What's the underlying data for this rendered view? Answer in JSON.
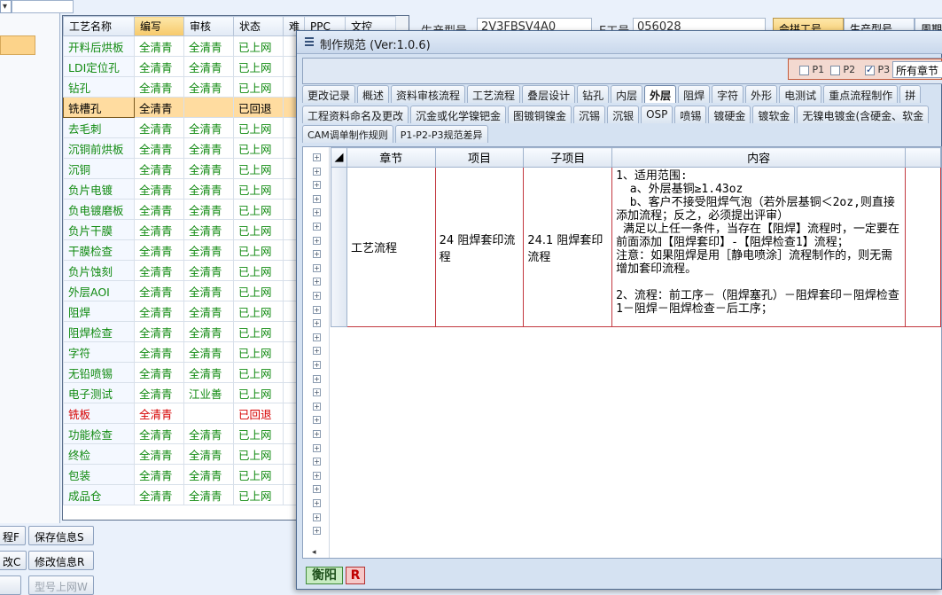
{
  "grid": {
    "columns": [
      "工艺名称",
      "编写",
      "审核",
      "状态",
      "难",
      "PPC",
      "文控"
    ],
    "rows": [
      {
        "name": "开料后烘板",
        "author": "全清青",
        "reviewer": "全清青",
        "status": "已上网",
        "state": "ok"
      },
      {
        "name": "LDI定位孔",
        "author": "全清青",
        "reviewer": "全清青",
        "status": "已上网",
        "state": "ok"
      },
      {
        "name": "钻孔",
        "author": "全清青",
        "reviewer": "全清青",
        "status": "已上网",
        "state": "ok"
      },
      {
        "name": "铣槽孔",
        "author": "全清青",
        "reviewer": "",
        "status": "已回退",
        "state": "sel"
      },
      {
        "name": "去毛刺",
        "author": "全清青",
        "reviewer": "全清青",
        "status": "已上网",
        "state": "ok"
      },
      {
        "name": "沉铜前烘板",
        "author": "全清青",
        "reviewer": "全清青",
        "status": "已上网",
        "state": "ok"
      },
      {
        "name": "沉铜",
        "author": "全清青",
        "reviewer": "全清青",
        "status": "已上网",
        "state": "ok"
      },
      {
        "name": "负片电镀",
        "author": "全清青",
        "reviewer": "全清青",
        "status": "已上网",
        "state": "ok"
      },
      {
        "name": "负电镀磨板",
        "author": "全清青",
        "reviewer": "全清青",
        "status": "已上网",
        "state": "ok"
      },
      {
        "name": "负片干膜",
        "author": "全清青",
        "reviewer": "全清青",
        "status": "已上网",
        "state": "ok"
      },
      {
        "name": "干膜检查",
        "author": "全清青",
        "reviewer": "全清青",
        "status": "已上网",
        "state": "ok"
      },
      {
        "name": "负片蚀刻",
        "author": "全清青",
        "reviewer": "全清青",
        "status": "已上网",
        "state": "ok"
      },
      {
        "name": "外层AOI",
        "author": "全清青",
        "reviewer": "全清青",
        "status": "已上网",
        "state": "ok"
      },
      {
        "name": "阻焊",
        "author": "全清青",
        "reviewer": "全清青",
        "status": "已上网",
        "state": "ok"
      },
      {
        "name": "阻焊检查",
        "author": "全清青",
        "reviewer": "全清青",
        "status": "已上网",
        "state": "ok"
      },
      {
        "name": "字符",
        "author": "全清青",
        "reviewer": "全清青",
        "status": "已上网",
        "state": "ok"
      },
      {
        "name": "无铅喷锡",
        "author": "全清青",
        "reviewer": "全清青",
        "status": "已上网",
        "state": "ok"
      },
      {
        "name": "电子测试",
        "author": "全清青",
        "reviewer": "江业善",
        "status": "已上网",
        "state": "ok"
      },
      {
        "name": "铣板",
        "author": "全清青",
        "reviewer": "",
        "status": "已回退",
        "state": "back"
      },
      {
        "name": "功能检查",
        "author": "全清青",
        "reviewer": "全清青",
        "status": "已上网",
        "state": "ok"
      },
      {
        "name": "终检",
        "author": "全清青",
        "reviewer": "全清青",
        "status": "已上网",
        "state": "ok"
      },
      {
        "name": "包装",
        "author": "全清青",
        "reviewer": "全清青",
        "status": "已上网",
        "state": "ok"
      },
      {
        "name": "成品仓",
        "author": "全清青",
        "reviewer": "全清青",
        "status": "已上网",
        "state": "ok"
      }
    ]
  },
  "buttons": {
    "left_top": "程F",
    "left_mid": "改C",
    "save_info": "保存信息S",
    "modify_info": "修改信息R",
    "model_online": "型号上网W"
  },
  "bgform": {
    "label_model": "生产型号",
    "model_value": "2V3FBSV4A0",
    "label_order": "E工号",
    "order_value": "056028",
    "tab_active": "会拼工号",
    "tab2": "生产型号",
    "tab3": "周期"
  },
  "window": {
    "title": "制作规范 (Ver:1.0.6)",
    "filters": [
      {
        "label": "P1",
        "checked": false
      },
      {
        "label": "P2",
        "checked": false
      },
      {
        "label": "P3",
        "checked": true
      }
    ],
    "section_combo": "所有章节",
    "tabs_row1": [
      "更改记录",
      "概述",
      "资料审核流程",
      "工艺流程",
      "叠层设计",
      "钻孔",
      "内层",
      "外层",
      "阻焊",
      "字符",
      "外形",
      "电测试",
      "重点流程制作",
      "拼"
    ],
    "active_tab": "外层",
    "tabs_row2": [
      "工程资料命名及更改",
      "沉金或化学镍钯金",
      "图镀铜镍金",
      "沉锡",
      "沉银",
      "OSP",
      "喷锡",
      "镀硬金",
      "镀软金",
      "无镍电镀金(含硬金、软金"
    ],
    "tabs_row3": [
      "CAM调单制作规则",
      "P1-P2-P3规范差异"
    ],
    "table": {
      "headers": [
        "章节",
        "项目",
        "子项目",
        "内容"
      ],
      "row": {
        "chapter": "工艺流程",
        "item": "24 阻焊套印流程",
        "subitem": "24.1 阻焊套印流程",
        "content": "1、适用范围:\n  a、外层基铜≥1.43oz\n  b、客户不接受阻焊气泡（若外层基铜＜2oz,则直接添加流程；反之，必须提出评审）\n 满足以上任一条件，当存在【阻焊】流程时，一定要在前面添加【阻焊套印】-【阻焊检查1】流程；\n注意：如果阻焊是用［静电喷涂］流程制作的，则无需增加套印流程。\n\n2、流程：前工序－（阻焊塞孔）－阻焊套印－阻焊检查1－阻焊－阻焊检查－后工序；"
      }
    },
    "status_badge_left": "衡阳",
    "status_badge_right": "R"
  },
  "colors": {
    "ok_text": "#108a10",
    "back_text": "#d60000",
    "selected_row": "#ffdca0",
    "header_highlight": "#f7c96a",
    "content_border": "#c2383f"
  },
  "icons": [
    "chevron-down-icon",
    "menu-icon",
    "tree-expand-icon",
    "checkbox-icon"
  ]
}
